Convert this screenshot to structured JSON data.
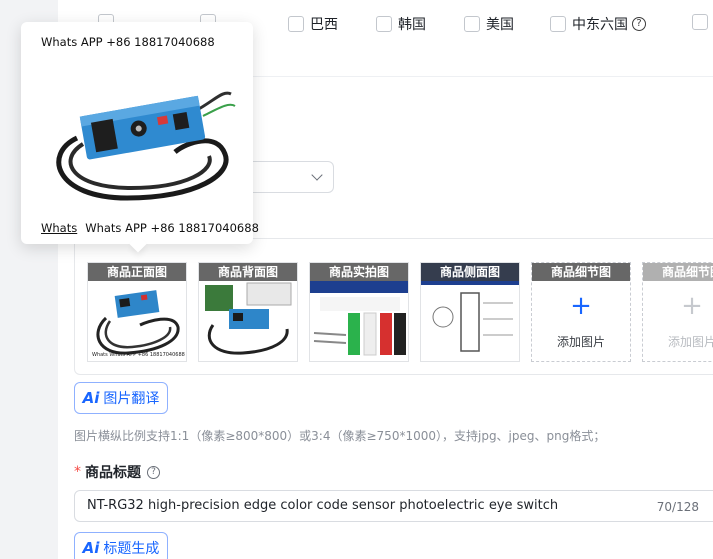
{
  "countries": [
    {
      "label": "巴西"
    },
    {
      "label": "韩国"
    },
    {
      "label": "美国"
    },
    {
      "label": "中东六国"
    }
  ],
  "help_glyph": "?",
  "popover": {
    "top_text": "Whats APP +86 18817040688",
    "bottom_prefix": "Whats",
    "bottom_text": "Whats APP +86 18817040688"
  },
  "images": {
    "slots": [
      {
        "caption": "商品正面图"
      },
      {
        "caption": "商品背面图"
      },
      {
        "caption": "商品实拍图"
      },
      {
        "caption": "商品侧面图"
      },
      {
        "caption": "商品细节图",
        "add_label": "添加图片"
      },
      {
        "caption": "商品细节图",
        "add_label": "添加图片"
      }
    ],
    "plus_glyph": "+",
    "thumb_footer": "Whats  Whats APP +86 18817040688"
  },
  "translate_button": {
    "ai": "Ai",
    "label": "图片翻译"
  },
  "hint": "图片横纵比例支持1:1（像素≥800*800）或3:4（像素≥750*1000），支持jpg、jpeg、png格式；",
  "title_field": {
    "required_mark": "*",
    "label": "商品标题",
    "value": "NT-RG32 high-precision edge color code sensor photoelectric eye switch",
    "count": "70/128"
  },
  "title_gen_button": {
    "ai": "Ai",
    "label": "标题生成"
  },
  "colors": {
    "accent": "#1966ff",
    "required": "#f54a45"
  }
}
